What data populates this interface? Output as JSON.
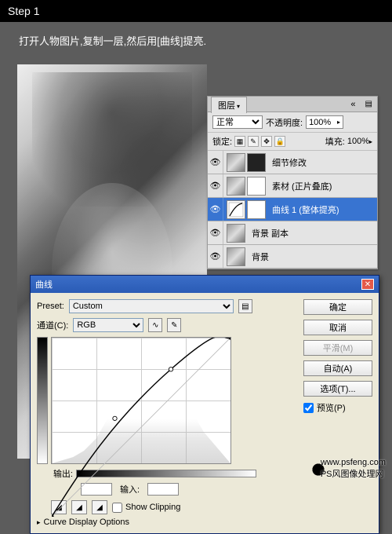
{
  "step_title": "Step 1",
  "instruction": "打开人物图片,复制一层,然后用[曲线]提亮.",
  "layers_panel": {
    "tab": "图层",
    "blend_mode": "正常",
    "opacity_label": "不透明度:",
    "opacity_value": "100%",
    "lock_label": "锁定:",
    "fill_label": "填充:",
    "fill_value": "100%",
    "layers": [
      {
        "name": "细节修改",
        "selected": false
      },
      {
        "name": "素材 (正片叠底)",
        "selected": false
      },
      {
        "name": "曲线 1 (整体提亮)",
        "selected": true
      },
      {
        "name": "背景 副本",
        "selected": false
      },
      {
        "name": "背景",
        "selected": false
      }
    ]
  },
  "curves_dialog": {
    "title": "曲线",
    "preset_label": "Preset:",
    "preset_value": "Custom",
    "channel_label": "通道(C):",
    "channel_value": "RGB",
    "output_label": "输出:",
    "input_label": "输入:",
    "show_clipping": "Show Clipping",
    "display_options": "Curve Display Options",
    "buttons": {
      "ok": "确定",
      "cancel": "取消",
      "smooth": "平滑(M)",
      "auto": "自动(A)",
      "options": "选项(T)...",
      "preview": "预览(P)"
    }
  },
  "watermark_text": "www.psfeng.com",
  "watermark_sub": "PS风图像处理网",
  "chart_data": {
    "type": "line",
    "title": "Curves adjustment",
    "xlabel": "输入",
    "ylabel": "输出",
    "x_range": [
      0,
      255
    ],
    "y_range": [
      0,
      255
    ],
    "series": [
      {
        "name": "curve",
        "points": [
          [
            0,
            0
          ],
          [
            40,
            65
          ],
          [
            90,
            140
          ],
          [
            170,
            210
          ],
          [
            255,
            255
          ]
        ]
      }
    ],
    "histogram_note": "grayscale histogram shown as background, peak around mid-dark tones"
  }
}
